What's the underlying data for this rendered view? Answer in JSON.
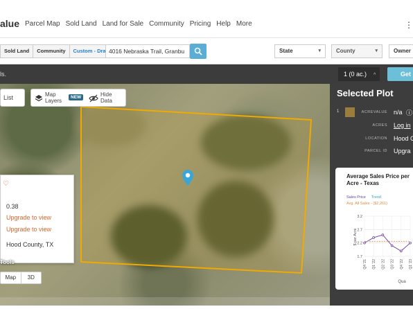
{
  "brand": {
    "name": "alue"
  },
  "nav": {
    "items": [
      "Parcel Map",
      "Sold Land",
      "Land for Sale",
      "Community",
      "Pricing",
      "Help",
      "More"
    ]
  },
  "search": {
    "tabs": [
      "Sold Land",
      "Community",
      "Custom - Draw"
    ],
    "address_value": "4016 Nebraska Trail, Granbu",
    "state_label": "State",
    "county_label": "County",
    "owner_label": "Owner"
  },
  "toolbar": {
    "message": "ls.",
    "plot_count": "1 (0 ac.)",
    "get_label": "Get"
  },
  "map": {
    "list_label": "List",
    "layers_label": "Map Layers",
    "new_badge": "NEW",
    "hide_label": "Hide Data",
    "tools_label": "Tools",
    "map_label": "Map",
    "view3d_label": "3D",
    "plot_color": "#f2a900"
  },
  "info_card": {
    "acres": "0.38",
    "upgrade1": "Upgrade to view",
    "upgrade2": "Upgrade to view",
    "county": "Hood County, TX"
  },
  "selected_plot": {
    "title": "Selected Plot",
    "index": "1",
    "rows": [
      {
        "key": "ACREVALUE",
        "value": "n/a"
      },
      {
        "key": "ACRES",
        "value": "Log in"
      },
      {
        "key": "LOCATION",
        "value": "Hood C"
      },
      {
        "key": "PARCEL ID",
        "value": "Upgra"
      }
    ]
  },
  "chart_data": {
    "type": "line",
    "title": "Average Sales Price per Acre - Texas",
    "legend": [
      "Sales Price",
      "Trend",
      "Avg. All Sales - ($2,261)"
    ],
    "ylabel": "$ per Acre",
    "xlabel": "Qua",
    "y_ticks": [
      "3.2",
      "2.7",
      "2.2",
      "1.7"
    ],
    "x_ticks": [
      "Q4 '21",
      "Q1 '22",
      "Q2 '22",
      "Q3 '22",
      "Q4 '22",
      "Q1 '23"
    ],
    "ylim": [
      1.7,
      3.2
    ],
    "series": [
      {
        "name": "Sales Price",
        "color": "#6a3ea1",
        "values": [
          2.2,
          2.4,
          2.5,
          2.1,
          1.9,
          2.2
        ]
      },
      {
        "name": "Avg. All Sales - ($2,261)",
        "color": "#e08a3c",
        "values": [
          2.26,
          2.26,
          2.26,
          2.26,
          2.26,
          2.26
        ]
      }
    ]
  }
}
